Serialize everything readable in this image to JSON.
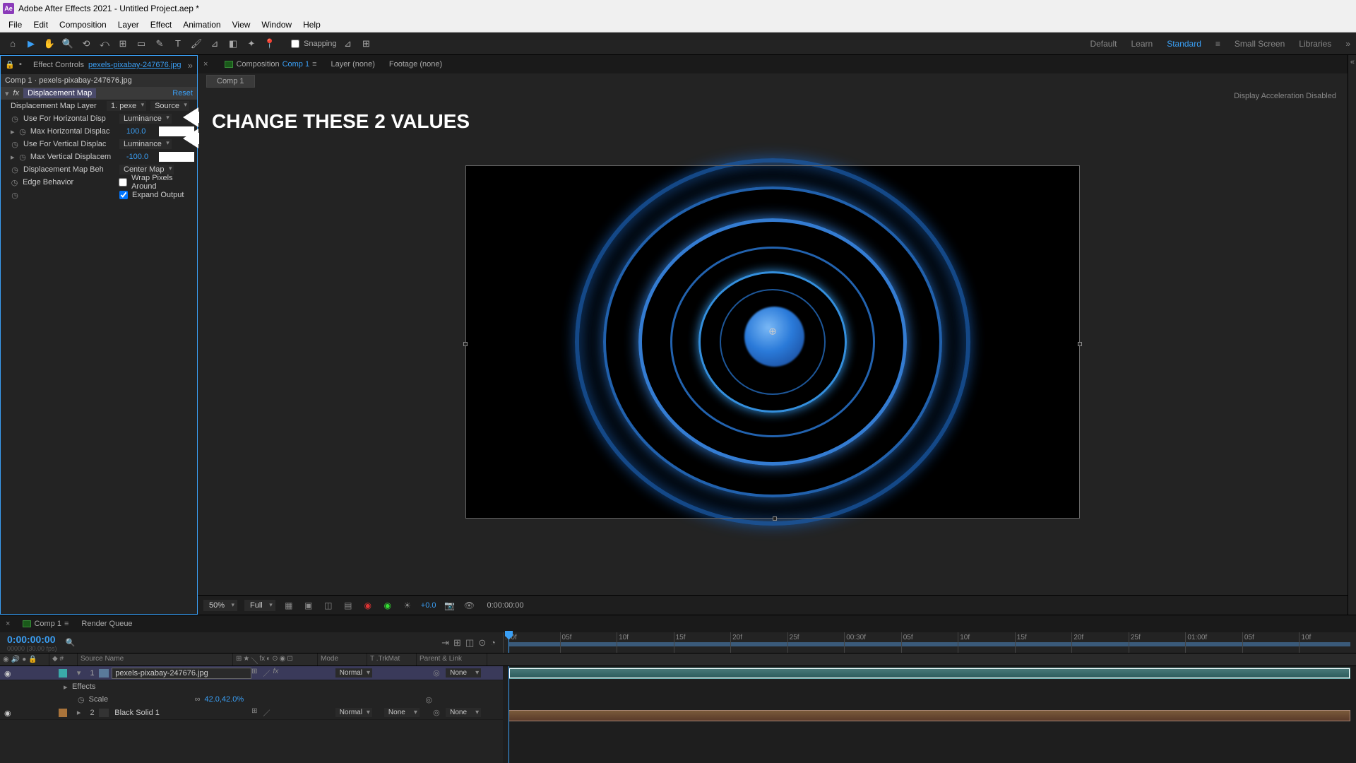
{
  "titlebar": {
    "text": "Adobe After Effects 2021 - Untitled Project.aep *"
  },
  "menu": {
    "items": [
      "File",
      "Edit",
      "Composition",
      "Layer",
      "Effect",
      "Animation",
      "View",
      "Window",
      "Help"
    ]
  },
  "toolbar": {
    "snapping_label": "Snapping"
  },
  "workspaces": {
    "items": [
      "Learn",
      "Default",
      "Standard",
      "Small Screen",
      "Libraries"
    ],
    "active": "Standard"
  },
  "effect_controls": {
    "panel_label": "Effect Controls",
    "layer_link": "pexels-pixabay-247676.jpg",
    "subtitle": "Comp 1 · pexels-pixabay-247676.jpg",
    "effect_name": "Displacement Map",
    "reset": "Reset",
    "props": {
      "map_layer_label": "Displacement Map Layer",
      "map_layer_val": "1. pexe",
      "map_layer_src": "Source",
      "use_h_label": "Use For Horizontal Disp",
      "use_h_val": "Luminance",
      "max_h_label": "Max Horizontal Displac",
      "max_h_val": "100.0",
      "use_v_label": "Use For Vertical Displac",
      "use_v_val": "Luminance",
      "max_v_label": "Max Vertical Displacem",
      "max_v_val": "-100.0",
      "beh_label": "Displacement Map Beh",
      "beh_val": "Center Map",
      "edge_label": "Edge Behavior",
      "wrap_label": "Wrap Pixels Around",
      "expand_label": "Expand Output"
    }
  },
  "annotation": {
    "text": "CHANGE THESE 2 VALUES"
  },
  "comp_panel": {
    "tab_prefix": "Composition",
    "tab_link": "Comp 1",
    "layer_tab": "Layer (none)",
    "footage_tab": "Footage (none)",
    "subtab": "Comp 1",
    "status": "Display Acceleration Disabled"
  },
  "viewer_footer": {
    "zoom": "50%",
    "res": "Full",
    "exposure": "+0.0",
    "timecode": "0:00:00:00"
  },
  "timeline": {
    "tab": "Comp 1",
    "render_queue": "Render Queue",
    "timecode": "0:00:00:00",
    "subcode": "00000 (30.00 fps)",
    "cols": {
      "source": "Source Name",
      "mode": "Mode",
      "trk": "T .TrkMat",
      "parent": "Parent & Link"
    },
    "ruler": [
      ":00f",
      "05f",
      "10f",
      "15f",
      "20f",
      "25f",
      "00:30f",
      "05f",
      "10f",
      "15f",
      "20f",
      "25f",
      "01:00f",
      "05f",
      "10f"
    ],
    "layer1": {
      "num": "1",
      "name": "pexels-pixabay-247676.jpg",
      "mode": "Normal",
      "parent": "None"
    },
    "effects_row": "Effects",
    "scale_row": {
      "name": "Scale",
      "val": "42.0,42.0%"
    },
    "layer2": {
      "num": "2",
      "name": "Black Solid 1",
      "mode": "Normal",
      "trk": "None",
      "parent": "None"
    }
  }
}
